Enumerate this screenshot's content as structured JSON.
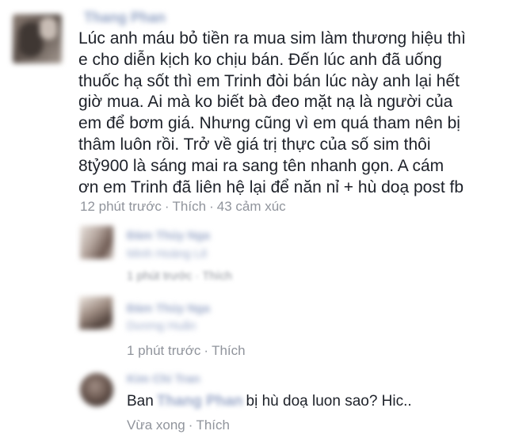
{
  "comment": {
    "author": "Thang Phan",
    "text": "Lúc anh máu bỏ tiền ra mua sim làm thương hiệu thì\ne cho diễn kịch ko chịu bán. Đến lúc anh đã uống\nthuốc hạ sốt thì em Trinh đòi bán lúc này anh lại hết\ngiờ mua. Ai mà ko biết bà đeo mặt nạ là người của\nem để bơm giá. Nhưng cũng vì em quá tham nên bị\nthâm luôn rồi. Trở về giá trị thực của số sim thôi\n8tỷ900 là sáng mai ra sang tên nhanh gọn. A cám\nơn em Trinh đã liên hệ lại để năn nỉ + hù doạ post fb",
    "time": "12 phút trước",
    "like": "Thích",
    "reactions": "43 cảm xúc",
    "separator": "·"
  },
  "replies": [
    {
      "author_line1": "Đàm Thúy Nga",
      "author_line2": "Minh Hoàng Lê",
      "time": "1 phút trước",
      "like": "Thích",
      "separator": "·"
    },
    {
      "author_line1": "Đàm Thúy Nga",
      "author_line2": "Dương Huấn",
      "time": "1 phút trước",
      "like": "Thích",
      "separator": "·"
    },
    {
      "author": "Kim Chi Tran",
      "text_before": "Ban",
      "mention": "Thang Phan",
      "text_after": "bị hù doạ luon sao? Hic..",
      "time": "Vừa xong",
      "like": "Thích",
      "separator": "·"
    }
  ]
}
